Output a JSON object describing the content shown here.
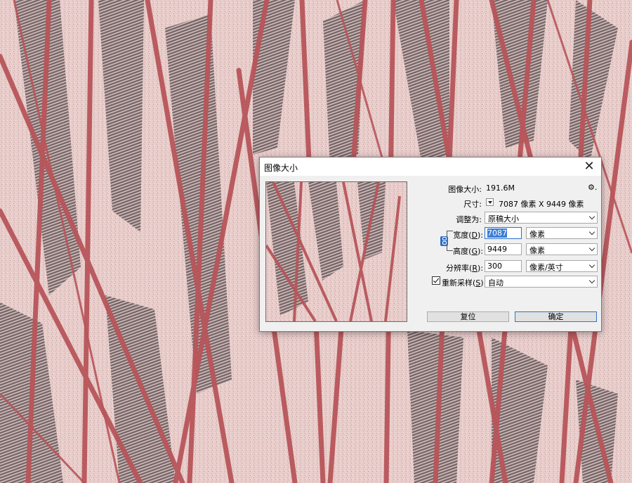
{
  "dialog": {
    "title": "图像大小",
    "close_glyph": "✕",
    "image_size_label": "图像大小:",
    "image_size_value": "191.6M",
    "gear_glyph": "⚙.",
    "dimensions_label": "尺寸:",
    "dimensions_value": "7087 像素  X  9449 像素",
    "fit_to_label": "调整为:",
    "fit_to_value": "原稿大小",
    "width_label": "宽度",
    "width_shortcut": "D",
    "width_value": "7087",
    "width_unit": "像素",
    "height_label": "高度",
    "height_shortcut": "G",
    "height_value": "9449",
    "height_unit": "像素",
    "resolution_label": "分辨率",
    "resolution_shortcut": "R",
    "resolution_value": "300",
    "resolution_unit": "像素/英寸",
    "resample_label": "重新采样",
    "resample_shortcut": "S",
    "resample_checked": true,
    "resample_value": "自动",
    "reset_button": "复位",
    "ok_button": "确定"
  },
  "colors": {
    "background": "#e8cdcb",
    "stem_red": "#b8555a",
    "leaf_dark": "#5f5657",
    "accent_blue": "#2f74c6"
  },
  "icons": {
    "close": "close-icon",
    "gear": "gear-icon",
    "link": "link-chain-icon",
    "dropdown": "chevron-down-icon"
  }
}
